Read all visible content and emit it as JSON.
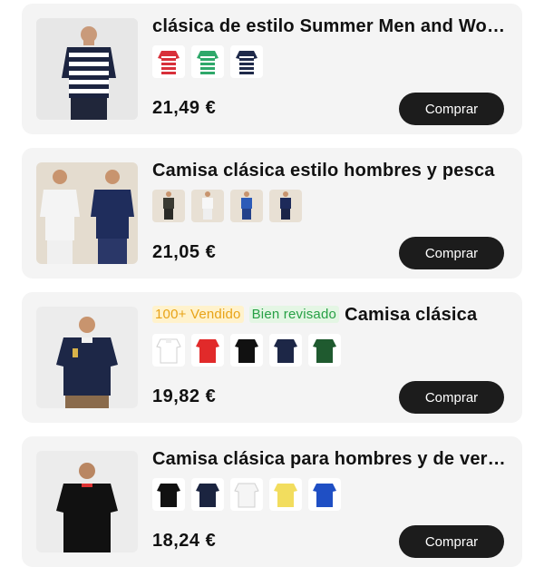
{
  "products": [
    {
      "title": "clásica de estilo Summer Men and Women",
      "badges": [],
      "swatch_colors": [
        "#d8303a",
        "#2fa86a",
        "#1f2a4a"
      ],
      "swatch_style": "striped-polo",
      "price": "21,49 €",
      "buy_label": "Comprar"
    },
    {
      "title": "Camisa clásica estilo hombres y pesca",
      "badges": [],
      "swatch_colors": [
        "#3a3a32",
        "#f1f1f1",
        "#2c5bb8",
        "#1d2a5a"
      ],
      "swatch_style": "photo-thumb",
      "price": "21,05 €",
      "buy_label": "Comprar"
    },
    {
      "title": "Camisa clásica",
      "badges": [
        {
          "text": "100+ Vendido",
          "type": "sold"
        },
        {
          "text": "Bien revisado",
          "type": "reviewed"
        }
      ],
      "swatch_colors": [
        "#ffffff",
        "#e12a2a",
        "#111111",
        "#1d2747",
        "#1f5a2f"
      ],
      "swatch_style": "polo",
      "price": "19,82 €",
      "buy_label": "Comprar"
    },
    {
      "title": "Camisa clásica para hombres y de verano",
      "badges": [],
      "swatch_colors": [
        "#111111",
        "#1b2440",
        "#f5f5f5",
        "#f2dd5e",
        "#1f4fc4"
      ],
      "swatch_style": "polo",
      "price": "18,24 €",
      "buy_label": "Comprar"
    }
  ],
  "colors": {
    "card_bg": "#f4f4f4",
    "button_bg": "#1c1c1c",
    "sold_badge_text": "#e8a317",
    "reviewed_badge_text": "#27a045"
  }
}
